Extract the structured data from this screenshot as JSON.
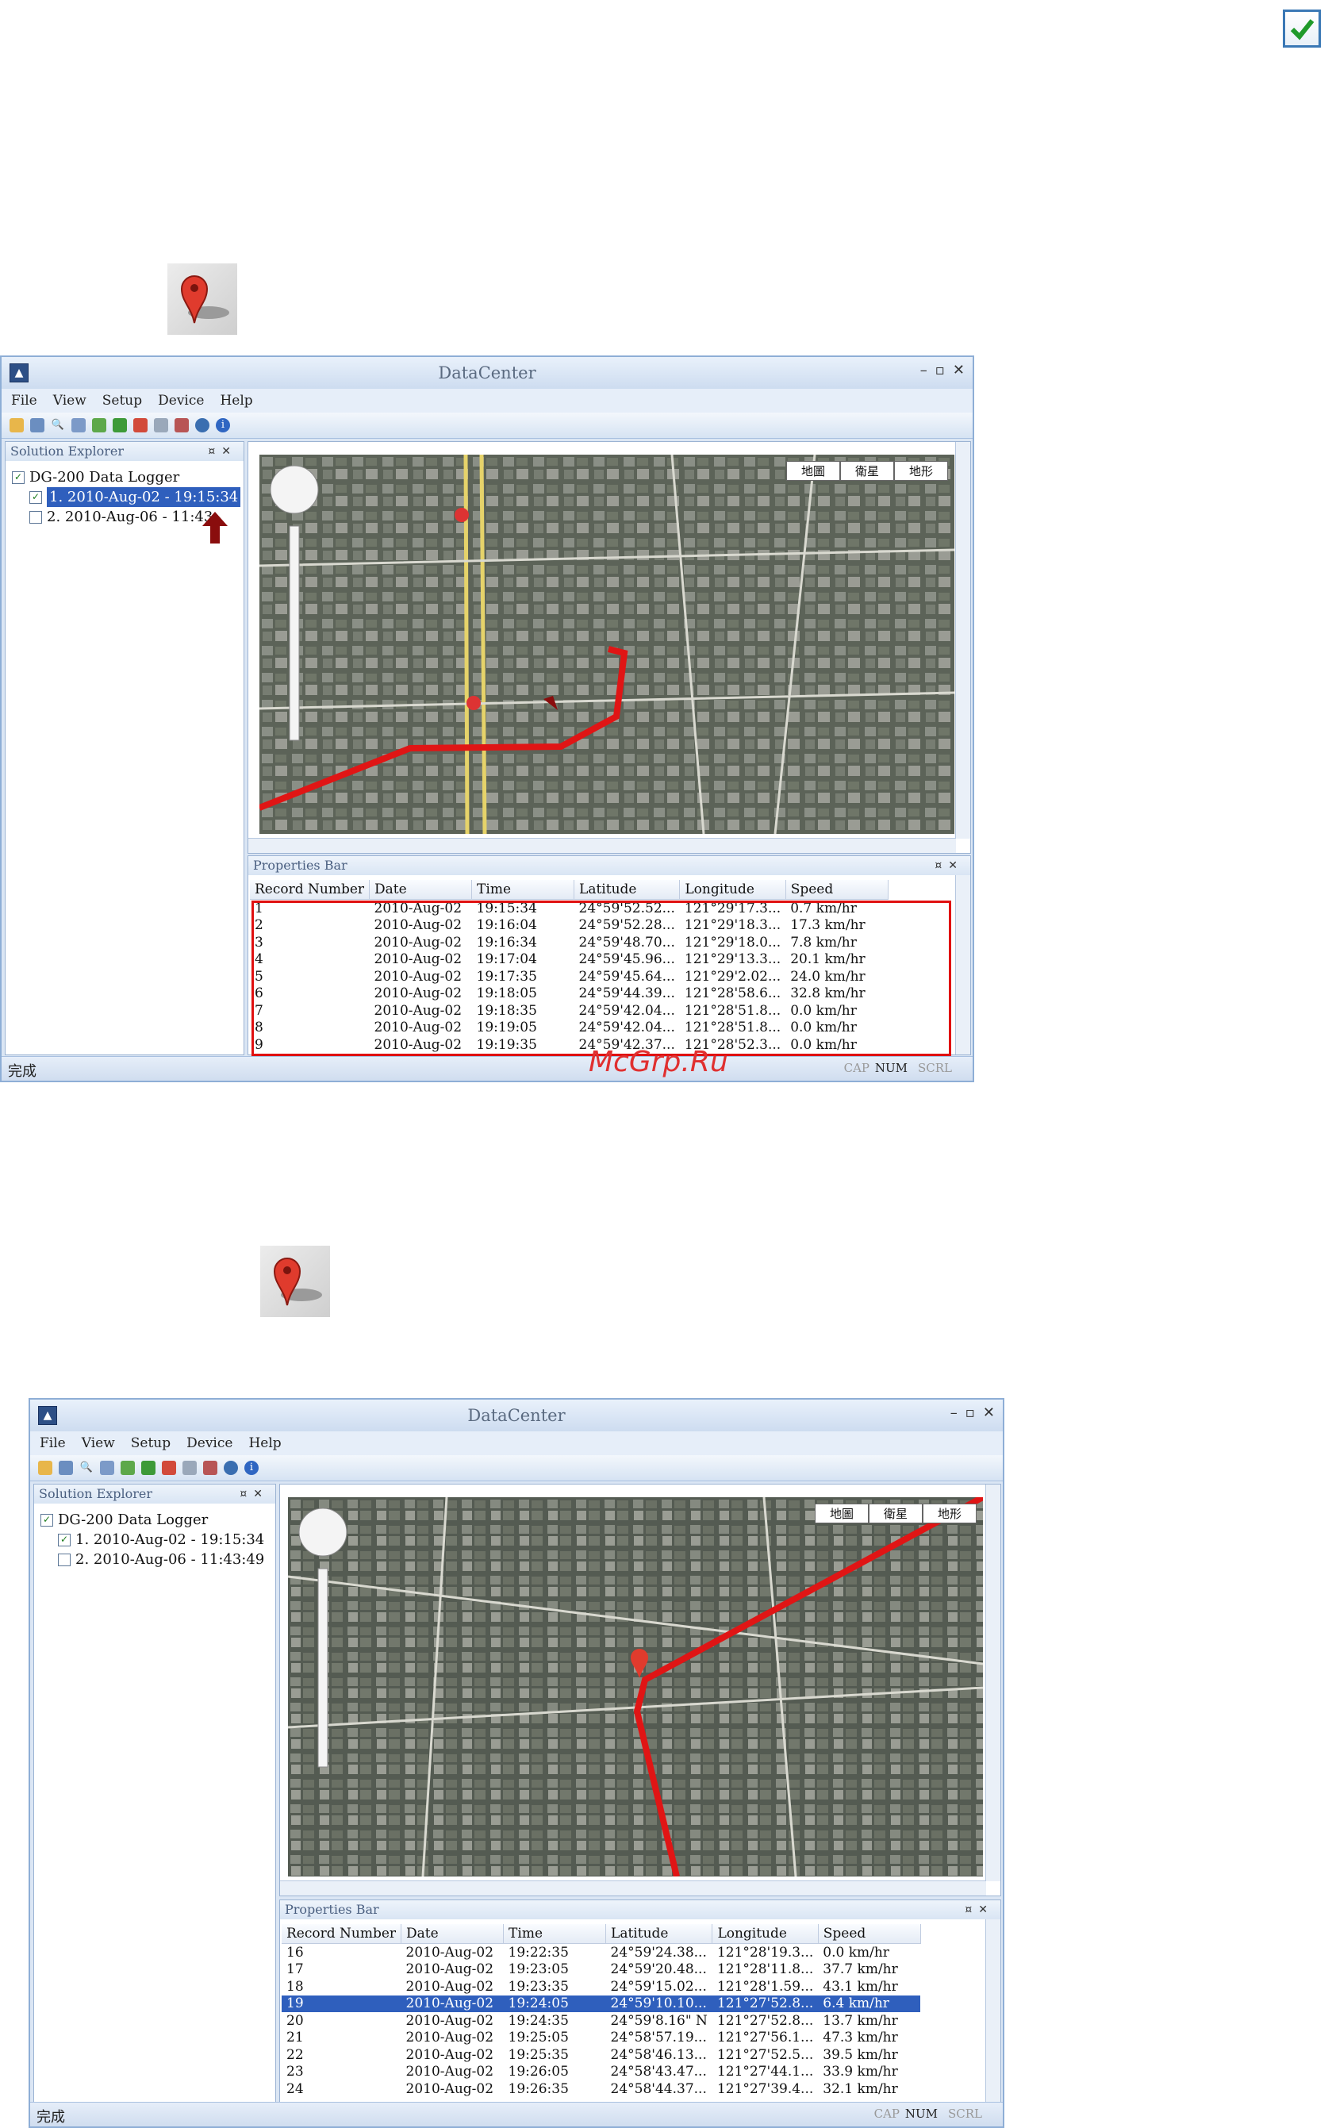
{
  "window_title": "DataCenter",
  "menu": [
    "File",
    "View",
    "Setup",
    "Device",
    "Help"
  ],
  "solution_explorer": {
    "title": "Solution Explorer",
    "root": "DG-200 Data Logger",
    "items": [
      "1. 2010-Aug-02 - 19:15:34",
      "2. 2010-Aug-06 - 11:43:49"
    ],
    "items_clipped_first": [
      "1. 2010-Aug-02 - 19:15:34",
      "2. 2010-Aug-06 - 11:43"
    ]
  },
  "map": {
    "tabs": [
      "地圖",
      "衛星",
      "地形"
    ]
  },
  "properties_bar": {
    "title": "Properties Bar",
    "columns": [
      "Record Number",
      "Date",
      "Time",
      "Latitude",
      "Longitude",
      "Speed"
    ]
  },
  "screenshot1_rows": [
    [
      "1",
      "2010-Aug-02",
      "19:15:34",
      "24°59'52.52...",
      "121°29'17.3...",
      "0.7 km/hr"
    ],
    [
      "2",
      "2010-Aug-02",
      "19:16:04",
      "24°59'52.28...",
      "121°29'18.3...",
      "17.3 km/hr"
    ],
    [
      "3",
      "2010-Aug-02",
      "19:16:34",
      "24°59'48.70...",
      "121°29'18.0...",
      "7.8 km/hr"
    ],
    [
      "4",
      "2010-Aug-02",
      "19:17:04",
      "24°59'45.96...",
      "121°29'13.3...",
      "20.1 km/hr"
    ],
    [
      "5",
      "2010-Aug-02",
      "19:17:35",
      "24°59'45.64...",
      "121°29'2.02...",
      "24.0 km/hr"
    ],
    [
      "6",
      "2010-Aug-02",
      "19:18:05",
      "24°59'44.39...",
      "121°28'58.6...",
      "32.8 km/hr"
    ],
    [
      "7",
      "2010-Aug-02",
      "19:18:35",
      "24°59'42.04...",
      "121°28'51.8...",
      "0.0 km/hr"
    ],
    [
      "8",
      "2010-Aug-02",
      "19:19:05",
      "24°59'42.04...",
      "121°28'51.8...",
      "0.0 km/hr"
    ],
    [
      "9",
      "2010-Aug-02",
      "19:19:35",
      "24°59'42.37...",
      "121°28'52.3...",
      "0.0 km/hr"
    ]
  ],
  "screenshot2_rows": [
    [
      "16",
      "2010-Aug-02",
      "19:22:35",
      "24°59'24.38...",
      "121°28'19.3...",
      "0.0 km/hr"
    ],
    [
      "17",
      "2010-Aug-02",
      "19:23:05",
      "24°59'20.48...",
      "121°28'11.8...",
      "37.7 km/hr"
    ],
    [
      "18",
      "2010-Aug-02",
      "19:23:35",
      "24°59'15.02...",
      "121°28'1.59...",
      "43.1 km/hr"
    ],
    [
      "19",
      "2010-Aug-02",
      "19:24:05",
      "24°59'10.10...",
      "121°27'52.8...",
      "6.4 km/hr"
    ],
    [
      "20",
      "2010-Aug-02",
      "19:24:35",
      "24°59'8.16\" N",
      "121°27'52.8...",
      "13.7 km/hr"
    ],
    [
      "21",
      "2010-Aug-02",
      "19:25:05",
      "24°58'57.19...",
      "121°27'56.1...",
      "47.3 km/hr"
    ],
    [
      "22",
      "2010-Aug-02",
      "19:25:35",
      "24°58'46.13...",
      "121°27'52.5...",
      "39.5 km/hr"
    ],
    [
      "23",
      "2010-Aug-02",
      "19:26:05",
      "24°58'43.47...",
      "121°27'44.1...",
      "33.9 km/hr"
    ],
    [
      "24",
      "2010-Aug-02",
      "19:26:35",
      "24°58'44.37...",
      "121°27'39.4...",
      "32.1 km/hr"
    ]
  ],
  "highlighted_record": "19",
  "status": {
    "left": "完成",
    "cap": "CAP",
    "num": "NUM",
    "scrl": "SCRL"
  },
  "watermark": "McGrp.Ru"
}
